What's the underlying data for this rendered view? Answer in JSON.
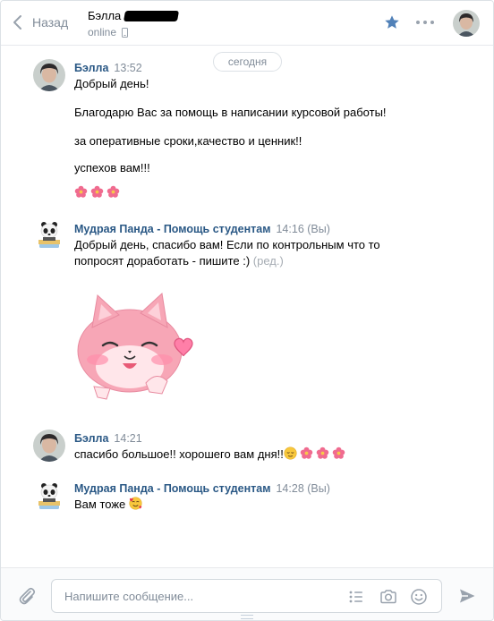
{
  "header": {
    "back_label": "Назад",
    "peer_name": "Бэлла",
    "peer_status": "online"
  },
  "date_pill": "сегодня",
  "messages": [
    {
      "author": "Бэлла",
      "time": "13:52",
      "lines": [
        "Добрый день!",
        "Благодарю Вас за помощь в написании курсовой работы!",
        "за оперативные сроки,качество и ценник!!",
        "успехов вам!!!"
      ],
      "emoji": [
        "flower-icon",
        "flower-icon",
        "flower-icon"
      ]
    },
    {
      "author": "Мудрая Панда - Помощь студентам",
      "time": "14:16",
      "you": "(Вы)",
      "lines": [
        "Добрый день, спасибо вам! Если по контрольным что то",
        "попросят доработать - пишите :)"
      ],
      "edited": "(ред.)",
      "sticker": "pink-cat-heart-sticker"
    },
    {
      "author": "Бэлла",
      "time": "14:21",
      "lines": [
        "спасибо большое!! хорошего вам дня!!"
      ],
      "emoji": [
        "relieved-face-icon",
        "flower-icon",
        "flower-icon",
        "flower-icon"
      ]
    },
    {
      "author": "Мудрая Панда - Помощь студентам",
      "time": "14:28",
      "you": "(Вы)",
      "lines": [
        "Вам тоже"
      ],
      "emoji": [
        "smiling-face-with-hearts-icon"
      ]
    }
  ],
  "composer": {
    "placeholder": "Напишите сообщение..."
  },
  "colors": {
    "link": "#2a5885",
    "accent": "#5181b8",
    "muted": "#818c99"
  }
}
